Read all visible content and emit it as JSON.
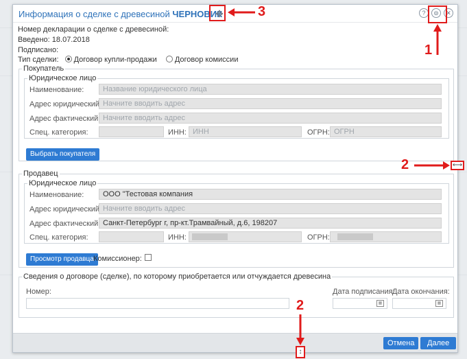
{
  "dialog": {
    "title_prefix": "Информация о сделке с древесиной",
    "title_status": "ЧЕРНОВИК",
    "icons": {
      "help": "help-icon",
      "settings": "settings-icon",
      "close": "close-icon"
    }
  },
  "info": {
    "declaration_number_label": "Номер декларации о сделке с древесиной:",
    "entered_label": "Введено:",
    "entered_value": "18.07.2018",
    "signed_label": "Подписано:",
    "deal_type_label": "Тип сделки:",
    "deal_type_options": [
      "Договор купли-продажи",
      "Договор комиссии"
    ],
    "deal_type_selected": "Договор купли-продажи"
  },
  "buyer": {
    "legend": "Покупатель",
    "entity_legend": "Юридическое лицо",
    "name_label": "Наименование:",
    "name_placeholder": "Название юридического лица",
    "legal_address_label": "Адрес юридический:",
    "legal_address_placeholder": "Начните вводить адрес",
    "actual_address_label": "Адрес фактический:",
    "actual_address_placeholder": "Начните вводить адрес",
    "special_category_label": "Спец. категория:",
    "inn_label": "ИНН:",
    "inn_placeholder": "ИНН",
    "ogrn_label": "ОГРН:",
    "ogrn_placeholder": "ОГРН",
    "select_button": "Выбрать покупателя"
  },
  "seller": {
    "legend": "Продавец",
    "entity_legend": "Юридическое лицо",
    "name_label": "Наименование:",
    "name_value": "ООО \"Тестовая компания",
    "legal_address_label": "Адрес юридический:",
    "legal_address_placeholder": "Начните вводить адрес",
    "actual_address_label": "Адрес фактический:",
    "actual_address_value": "Санкт-Петербург г, пр-кт.Трамвайный, д.6, 198207",
    "special_category_label": "Спец. категория:",
    "inn_label": "ИНН:",
    "ogrn_label": "ОГРН:",
    "view_button": "Просмотр продавца",
    "commissioner_label": "Комиссионер:"
  },
  "contract": {
    "legend": "Сведения о договоре (сделке), по которому приобретается или отчуждается древесина",
    "number_label": "Номер:",
    "sign_date_label": "Дата подписания:",
    "end_date_label": "Дата окончания:"
  },
  "footer": {
    "cancel_button": "Отмена",
    "next_button": "Далее"
  },
  "annotations": {
    "label_1": "1",
    "label_2_right": "2",
    "label_2_bottom": "2",
    "label_3": "3"
  }
}
